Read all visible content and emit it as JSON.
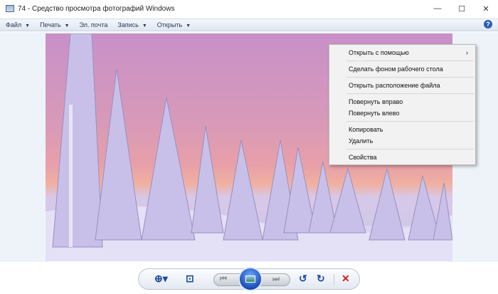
{
  "window": {
    "title": "74 - Средство просмотра фотографий Windows",
    "minimize": "—",
    "maximize": "☐",
    "close": "✕"
  },
  "menu": [
    {
      "label": "Файл",
      "dropdown": true
    },
    {
      "label": "Печать",
      "dropdown": true
    },
    {
      "label": "Эл. почта",
      "dropdown": false
    },
    {
      "label": "Запись",
      "dropdown": true
    },
    {
      "label": "Открыть",
      "dropdown": true
    }
  ],
  "help": "?",
  "context_menu": [
    "Открыть с помощью",
    "Сделать фоном рабочего стола",
    "Открыть расположение файла",
    "Повернуть вправо",
    "Повернуть влево",
    "Копировать",
    "Удалить",
    "Свойства"
  ],
  "toolbar": {
    "zoom": "⊕▾",
    "fit": "⊡",
    "prev": "⏮",
    "next": "⏭",
    "rotate_left": "↺",
    "rotate_right": "↻",
    "delete": "✕"
  },
  "accent": "#1b4a9c"
}
